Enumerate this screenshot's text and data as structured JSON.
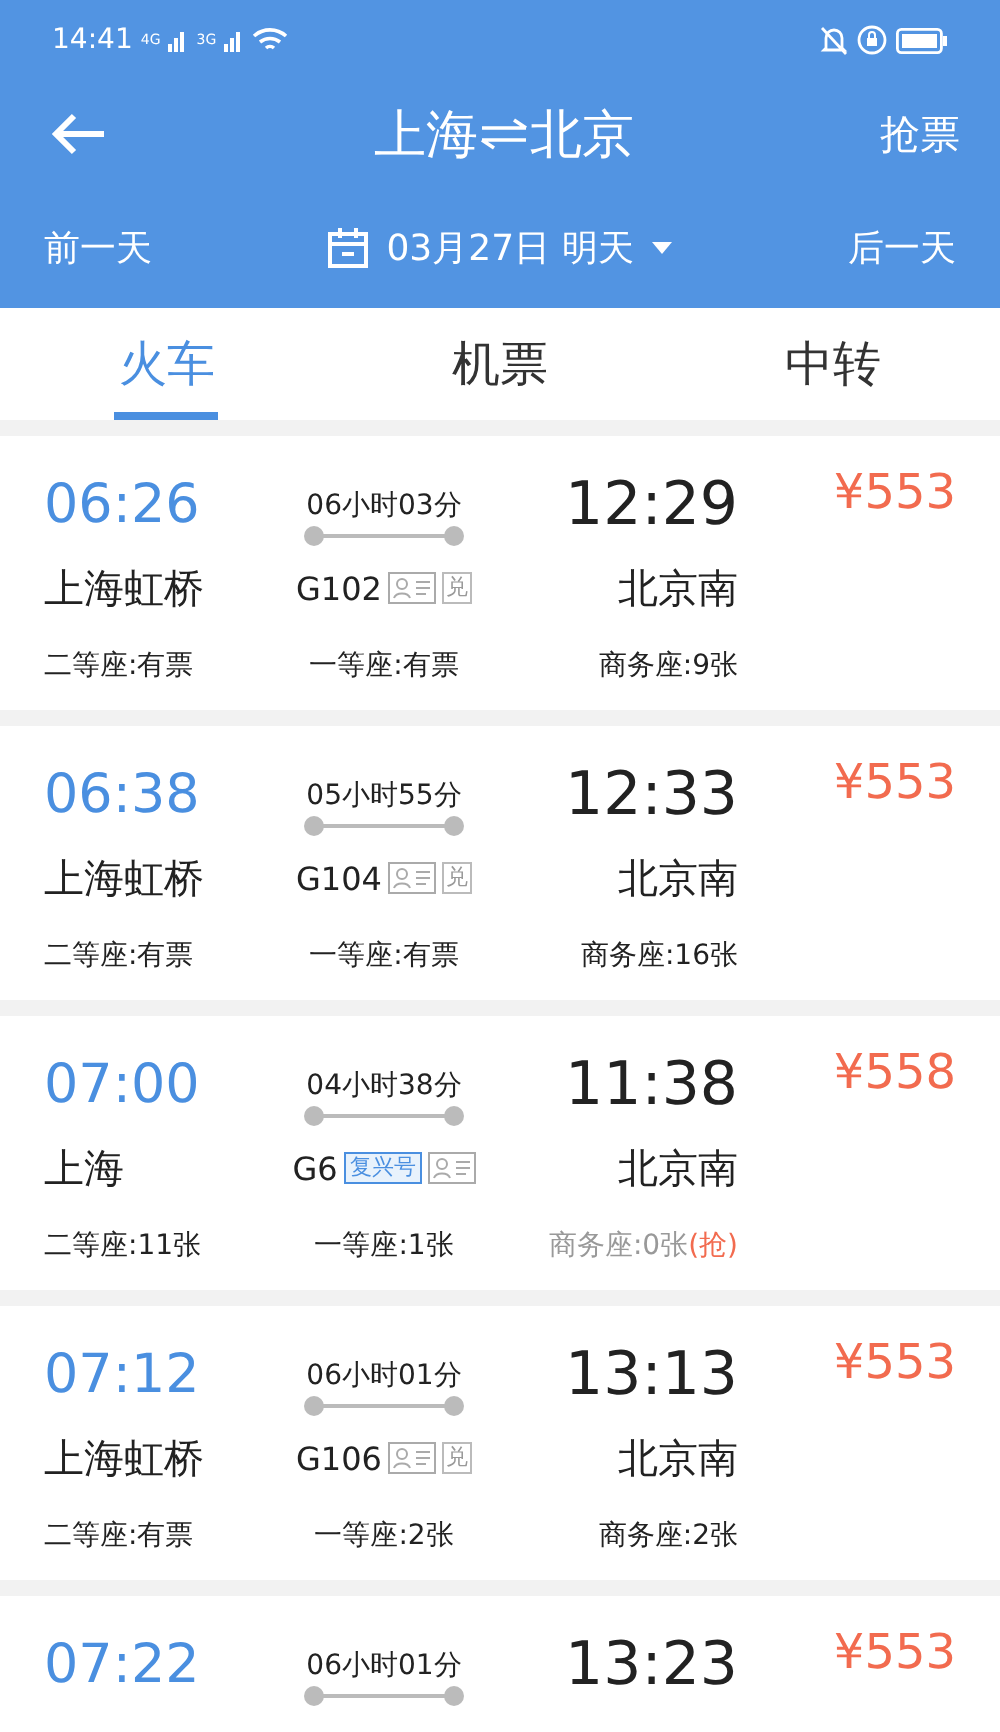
{
  "status_bar": {
    "time": "14:41",
    "net_1": "4G",
    "net_2": "3G"
  },
  "header": {
    "from": "上海",
    "to": "北京",
    "action": "抢票"
  },
  "date_bar": {
    "prev": "前一天",
    "date": "03月27日 明天",
    "next": "后一天"
  },
  "tabs": [
    {
      "label": "火车",
      "selected": true
    },
    {
      "label": "机票",
      "selected": false
    },
    {
      "label": "中转",
      "selected": false
    }
  ],
  "trains": [
    {
      "depart": "06:26",
      "from": "上海虹桥",
      "duration": "06小时03分",
      "code": "G102",
      "badges": [
        {
          "kind": "id"
        },
        {
          "kind": "text",
          "label": "兑"
        }
      ],
      "arrive": "12:29",
      "to": "北京南",
      "price": "¥553",
      "seats": [
        {
          "text": "二等座:有票",
          "available": true
        },
        {
          "text": "一等座:有票",
          "available": true
        },
        {
          "text": "商务座:9张",
          "available": true
        }
      ]
    },
    {
      "depart": "06:38",
      "from": "上海虹桥",
      "duration": "05小时55分",
      "code": "G104",
      "badges": [
        {
          "kind": "id"
        },
        {
          "kind": "text",
          "label": "兑"
        }
      ],
      "arrive": "12:33",
      "to": "北京南",
      "price": "¥553",
      "seats": [
        {
          "text": "二等座:有票",
          "available": true
        },
        {
          "text": "一等座:有票",
          "available": true
        },
        {
          "text": "商务座:16张",
          "available": true
        }
      ]
    },
    {
      "depart": "07:00",
      "from": "上海",
      "duration": "04小时38分",
      "code": "G6",
      "badges": [
        {
          "kind": "brand",
          "label": "复兴号"
        },
        {
          "kind": "id"
        }
      ],
      "arrive": "11:38",
      "to": "北京南",
      "price": "¥558",
      "seats": [
        {
          "text": "二等座:11张",
          "available": true
        },
        {
          "text": "一等座:1张",
          "available": true
        },
        {
          "text": "商务座:0张",
          "available": false,
          "grab": "(抢)"
        }
      ]
    },
    {
      "depart": "07:12",
      "from": "上海虹桥",
      "duration": "06小时01分",
      "code": "G106",
      "badges": [
        {
          "kind": "id"
        },
        {
          "kind": "text",
          "label": "兑"
        }
      ],
      "arrive": "13:13",
      "to": "北京南",
      "price": "¥553",
      "seats": [
        {
          "text": "二等座:有票",
          "available": true
        },
        {
          "text": "一等座:2张",
          "available": true
        },
        {
          "text": "商务座:2张",
          "available": true
        }
      ]
    },
    {
      "depart": "07:22",
      "duration": "06小时01分",
      "arrive": "13:23",
      "price": "¥553"
    }
  ]
}
